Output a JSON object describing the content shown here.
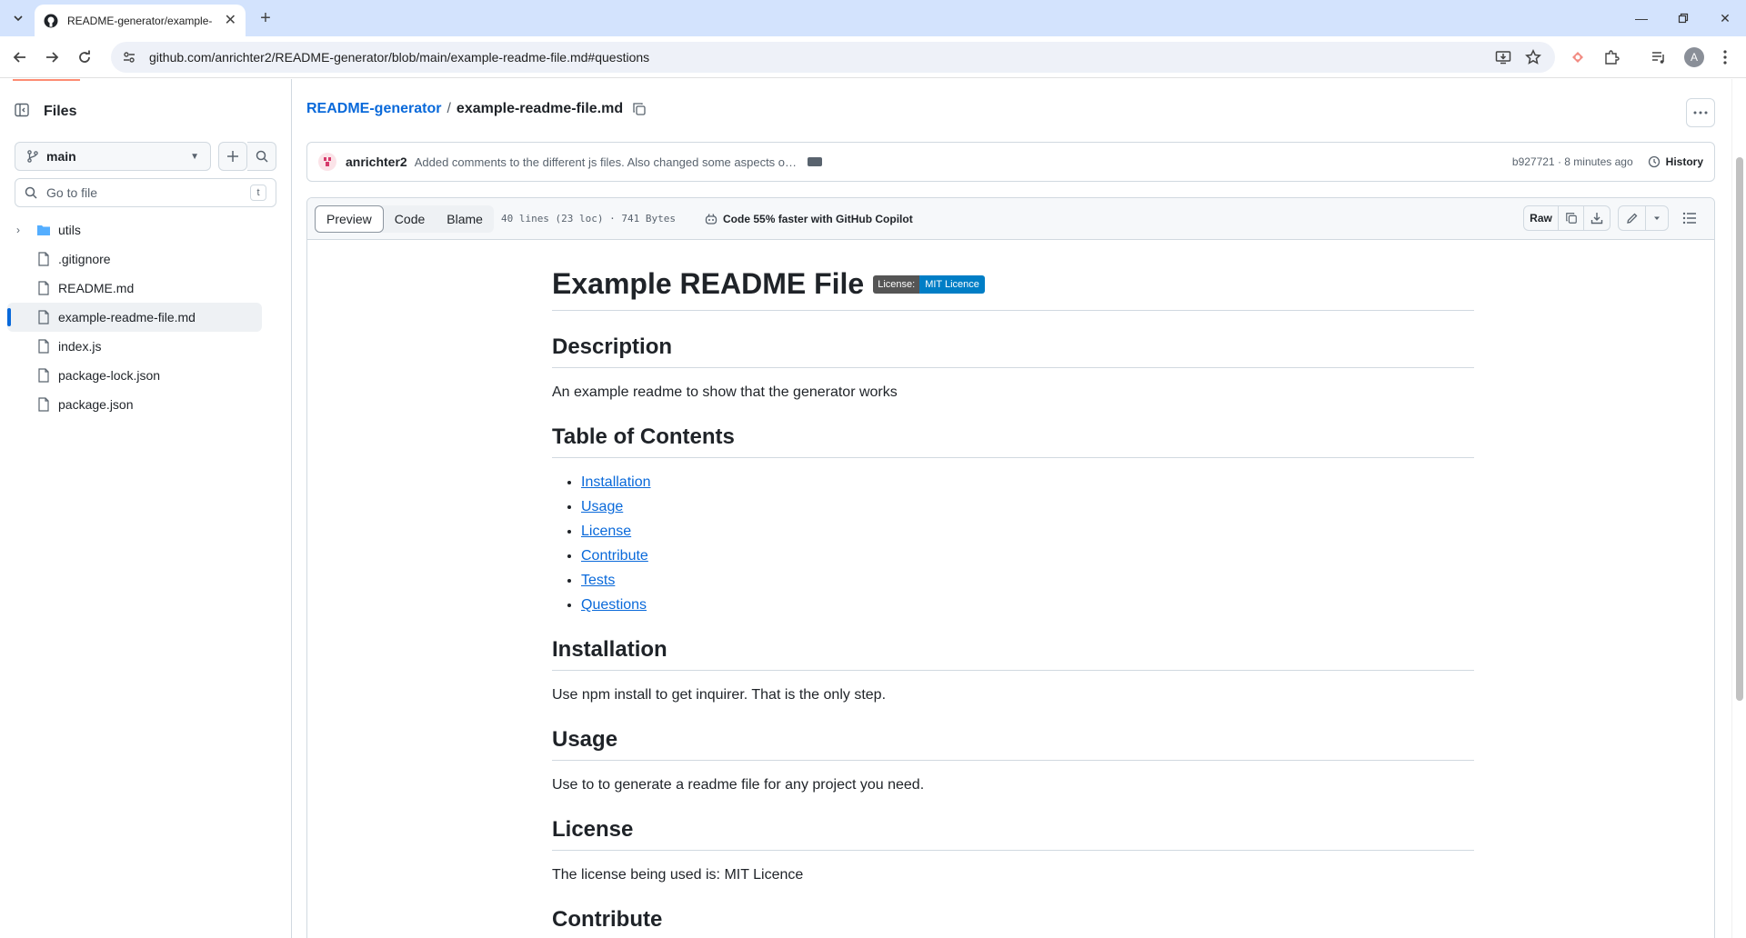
{
  "browser": {
    "tab_title": "README-generator/example-re",
    "url": "github.com/anrichter2/README-generator/blob/main/example-readme-file.md#questions",
    "avatar_letter": "A"
  },
  "sidebar": {
    "title": "Files",
    "branch": "main",
    "goto_placeholder": "Go to file",
    "goto_shortcut": "t",
    "items": [
      {
        "label": "utils"
      },
      {
        "label": ".gitignore"
      },
      {
        "label": "README.md"
      },
      {
        "label": "example-readme-file.md"
      },
      {
        "label": "index.js"
      },
      {
        "label": "package-lock.json"
      },
      {
        "label": "package.json"
      }
    ]
  },
  "breadcrumb": {
    "repo": "README-generator",
    "separator": "/",
    "file": "example-readme-file.md"
  },
  "commit": {
    "author": "anrichter2",
    "message": "Added comments to the different js files. Also changed some aspects o…",
    "meta": "b927721 · 8 minutes ago",
    "history_label": "History"
  },
  "file_header": {
    "tabs": [
      "Preview",
      "Code",
      "Blame"
    ],
    "info": "40 lines (23 loc) · 741 Bytes",
    "copilot": "Code 55% faster with GitHub Copilot",
    "raw_label": "Raw"
  },
  "readme": {
    "title": "Example README File",
    "badge_label": "License:",
    "badge_value": "MIT Licence",
    "description_heading": "Description",
    "description_text": "An example readme to show that the generator works",
    "toc_heading": "Table of Contents",
    "toc": [
      "Installation",
      "Usage",
      "License",
      "Contribute",
      "Tests",
      "Questions"
    ],
    "installation_heading": "Installation",
    "installation_text": "Use npm install to get inquirer. That is the only step.",
    "usage_heading": "Usage",
    "usage_text": "Use to to generate a readme file for any project you need.",
    "license_heading": "License",
    "license_text": "The license being used is: MIT Licence",
    "contribute_heading": "Contribute"
  },
  "colors": {
    "link": "#0969da",
    "badge_left": "#555555",
    "badge_right": "#007ec6",
    "tab_bar": "#d3e3fd"
  }
}
